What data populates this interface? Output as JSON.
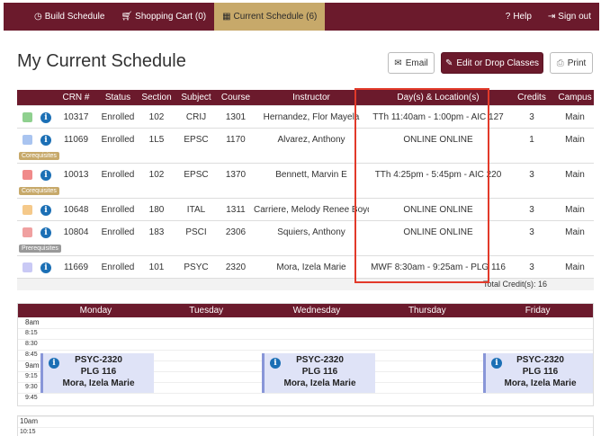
{
  "nav": {
    "build": "Build Schedule",
    "cart": "Shopping Cart (0)",
    "current": "Current Schedule (6)",
    "help": "Help",
    "signout": "Sign out"
  },
  "page": {
    "title": "My Current Schedule"
  },
  "actions": {
    "email": "Email",
    "edit": "Edit or Drop Classes",
    "print": "Print"
  },
  "table": {
    "headers": [
      "",
      "",
      "CRN #",
      "Status",
      "Section",
      "Subject",
      "Course",
      "Instructor",
      "Day(s) & Location(s)",
      "Credits",
      "Campus"
    ],
    "rows": [
      {
        "color": "#8fd08f",
        "crn": "10317",
        "status": "Enrolled",
        "section": "102",
        "subject": "CRIJ",
        "course": "1301",
        "instructor": "Hernandez, Flor Mayela",
        "days": "TTh 11:40am - 1:00pm - AIC 127",
        "credits": "3",
        "campus": "Main",
        "tag": ""
      },
      {
        "color": "#a9c4f0",
        "crn": "11069",
        "status": "Enrolled",
        "section": "1L5",
        "subject": "EPSC",
        "course": "1170",
        "instructor": "Alvarez, Anthony",
        "days": "ONLINE ONLINE",
        "credits": "1",
        "campus": "Main",
        "tag": "Corequisites"
      },
      {
        "color": "#f08a8a",
        "crn": "10013",
        "status": "Enrolled",
        "section": "102",
        "subject": "EPSC",
        "course": "1370",
        "instructor": "Bennett, Marvin E",
        "days": "TTh 4:25pm - 5:45pm - AIC 220",
        "credits": "3",
        "campus": "Main",
        "tag": "Corequisites"
      },
      {
        "color": "#f5c98a",
        "crn": "10648",
        "status": "Enrolled",
        "section": "180",
        "subject": "ITAL",
        "course": "1311",
        "instructor": "Carriere, Melody Renee Boyd",
        "days": "ONLINE ONLINE",
        "credits": "3",
        "campus": "Main",
        "tag": ""
      },
      {
        "color": "#f0a0a0",
        "crn": "10804",
        "status": "Enrolled",
        "section": "183",
        "subject": "PSCI",
        "course": "2306",
        "instructor": "Squiers, Anthony",
        "days": "ONLINE ONLINE",
        "credits": "3",
        "campus": "Main",
        "tag": "Prerequisites"
      },
      {
        "color": "#c9c9f5",
        "crn": "11669",
        "status": "Enrolled",
        "section": "101",
        "subject": "PSYC",
        "course": "2320",
        "instructor": "Mora, Izela Marie",
        "days": "MWF 8:30am - 9:25am - PLG 116",
        "credits": "3",
        "campus": "Main",
        "tag": ""
      }
    ],
    "total": "Total Credit(s): 16"
  },
  "calendar": {
    "days": [
      "Monday",
      "Tuesday",
      "Wednesday",
      "Thursday",
      "Friday"
    ],
    "times": [
      "8am",
      "8:15",
      "8:30",
      "8:45",
      "9am",
      "9:15",
      "9:30",
      "9:45"
    ],
    "times2": [
      "10am",
      "10:15"
    ],
    "event": {
      "course": "PSYC-2320",
      "room": "PLG 116",
      "instructor": "Mora, Izela Marie",
      "info": "i"
    }
  },
  "icons": {
    "info": "i"
  }
}
